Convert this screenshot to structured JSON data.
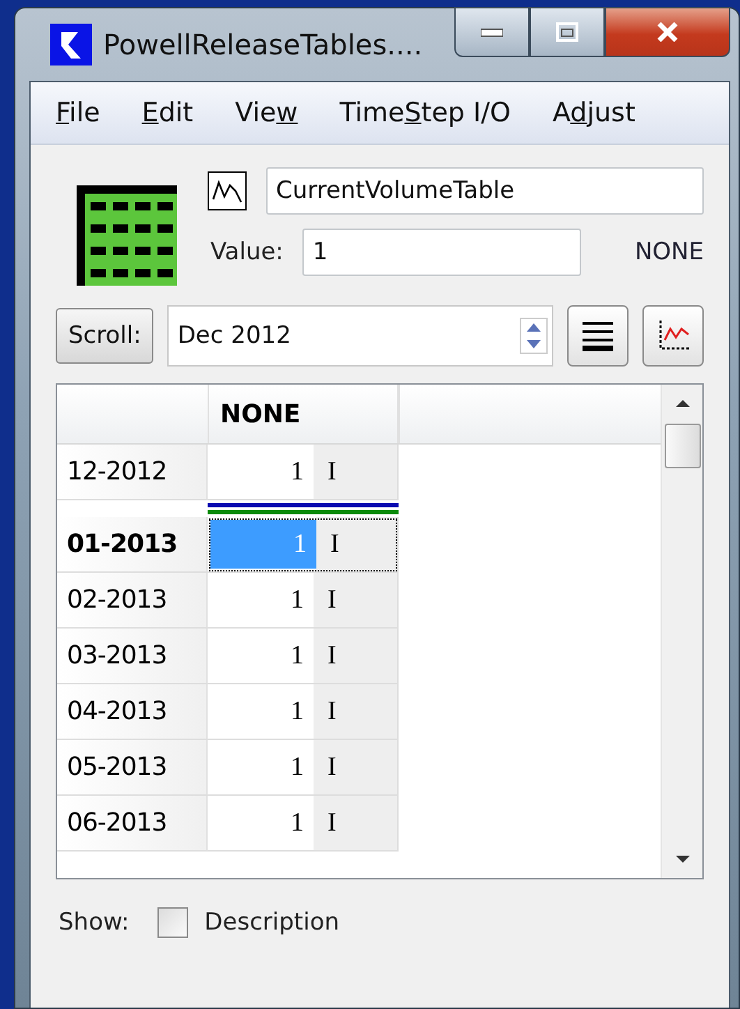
{
  "window": {
    "title": "PowellReleaseTables...."
  },
  "menu": [
    {
      "key": "F",
      "post": "ile"
    },
    {
      "key": "E",
      "post": "dit"
    },
    {
      "pre": "Vie",
      "key": "w"
    },
    {
      "pre": "Time",
      "key": "S",
      "post": "tep I/O"
    },
    {
      "pre": "A",
      "key": "d",
      "post": "just"
    }
  ],
  "slot": {
    "name": "CurrentVolumeTable",
    "value_label": "Value:",
    "value": "1",
    "unit": "NONE"
  },
  "scroll": {
    "button": "Scroll:",
    "date": "Dec 2012"
  },
  "table": {
    "columns": [
      "NONE"
    ],
    "rows": [
      {
        "date": "12-2012",
        "value": "1",
        "flag": "I",
        "selected": false,
        "current": false
      },
      {
        "date": "01-2013",
        "value": "1",
        "flag": "I",
        "selected": true,
        "current": true
      },
      {
        "date": "02-2013",
        "value": "1",
        "flag": "I",
        "selected": false,
        "current": false
      },
      {
        "date": "03-2013",
        "value": "1",
        "flag": "I",
        "selected": false,
        "current": false
      },
      {
        "date": "04-2013",
        "value": "1",
        "flag": "I",
        "selected": false,
        "current": false
      },
      {
        "date": "05-2013",
        "value": "1",
        "flag": "I",
        "selected": false,
        "current": false
      },
      {
        "date": "06-2013",
        "value": "1",
        "flag": "I",
        "selected": false,
        "current": false
      }
    ]
  },
  "show": {
    "label": "Show:",
    "option": "Description",
    "checked": false
  }
}
